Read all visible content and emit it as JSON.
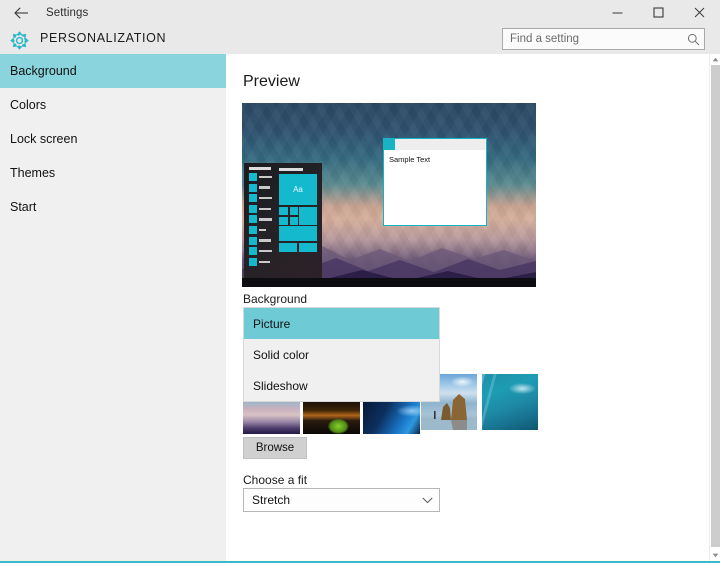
{
  "window": {
    "title": "Settings",
    "back_icon": "back-arrow-icon",
    "minimize_label": "Minimize",
    "maximize_label": "Maximize",
    "close_label": "Close",
    "accent_color": "#3cb8c6"
  },
  "header": {
    "gear_icon": "gear-icon",
    "page_title": "PERSONALIZATION",
    "search": {
      "placeholder": "Find a setting",
      "value": "",
      "icon": "search-icon"
    }
  },
  "sidebar": {
    "items": [
      {
        "label": "Background",
        "selected": true
      },
      {
        "label": "Colors",
        "selected": false
      },
      {
        "label": "Lock screen",
        "selected": false
      },
      {
        "label": "Themes",
        "selected": false
      },
      {
        "label": "Start",
        "selected": false
      }
    ],
    "selected_color": "#8ad5dd"
  },
  "main": {
    "section_title": "Preview",
    "preview": {
      "sample_window_text": "Sample Text",
      "tile_text": "Aa",
      "accent_color": "#14b9cd"
    },
    "background": {
      "label": "Background",
      "selected_value": "Picture",
      "dropdown_open": true,
      "options": [
        {
          "label": "Picture",
          "selected": true
        },
        {
          "label": "Solid color",
          "selected": false
        },
        {
          "label": "Slideshow",
          "selected": false
        }
      ],
      "highlight_color": "#6ecbd6",
      "thumbnails": [
        {
          "name": "thumbnail-sunset-clouds",
          "size": "small"
        },
        {
          "name": "thumbnail-night-tent",
          "size": "small"
        },
        {
          "name": "thumbnail-blue-hero",
          "size": "small"
        },
        {
          "name": "thumbnail-beach-rock",
          "size": "big"
        },
        {
          "name": "thumbnail-underwater",
          "size": "big"
        }
      ],
      "browse_label": "Browse"
    },
    "fit": {
      "label": "Choose a fit",
      "selected_value": "Stretch",
      "chevron_icon": "chevron-down-icon"
    }
  },
  "scrollbar": {
    "up_icon": "scroll-up-arrow-icon",
    "down_icon": "scroll-down-arrow-icon"
  }
}
